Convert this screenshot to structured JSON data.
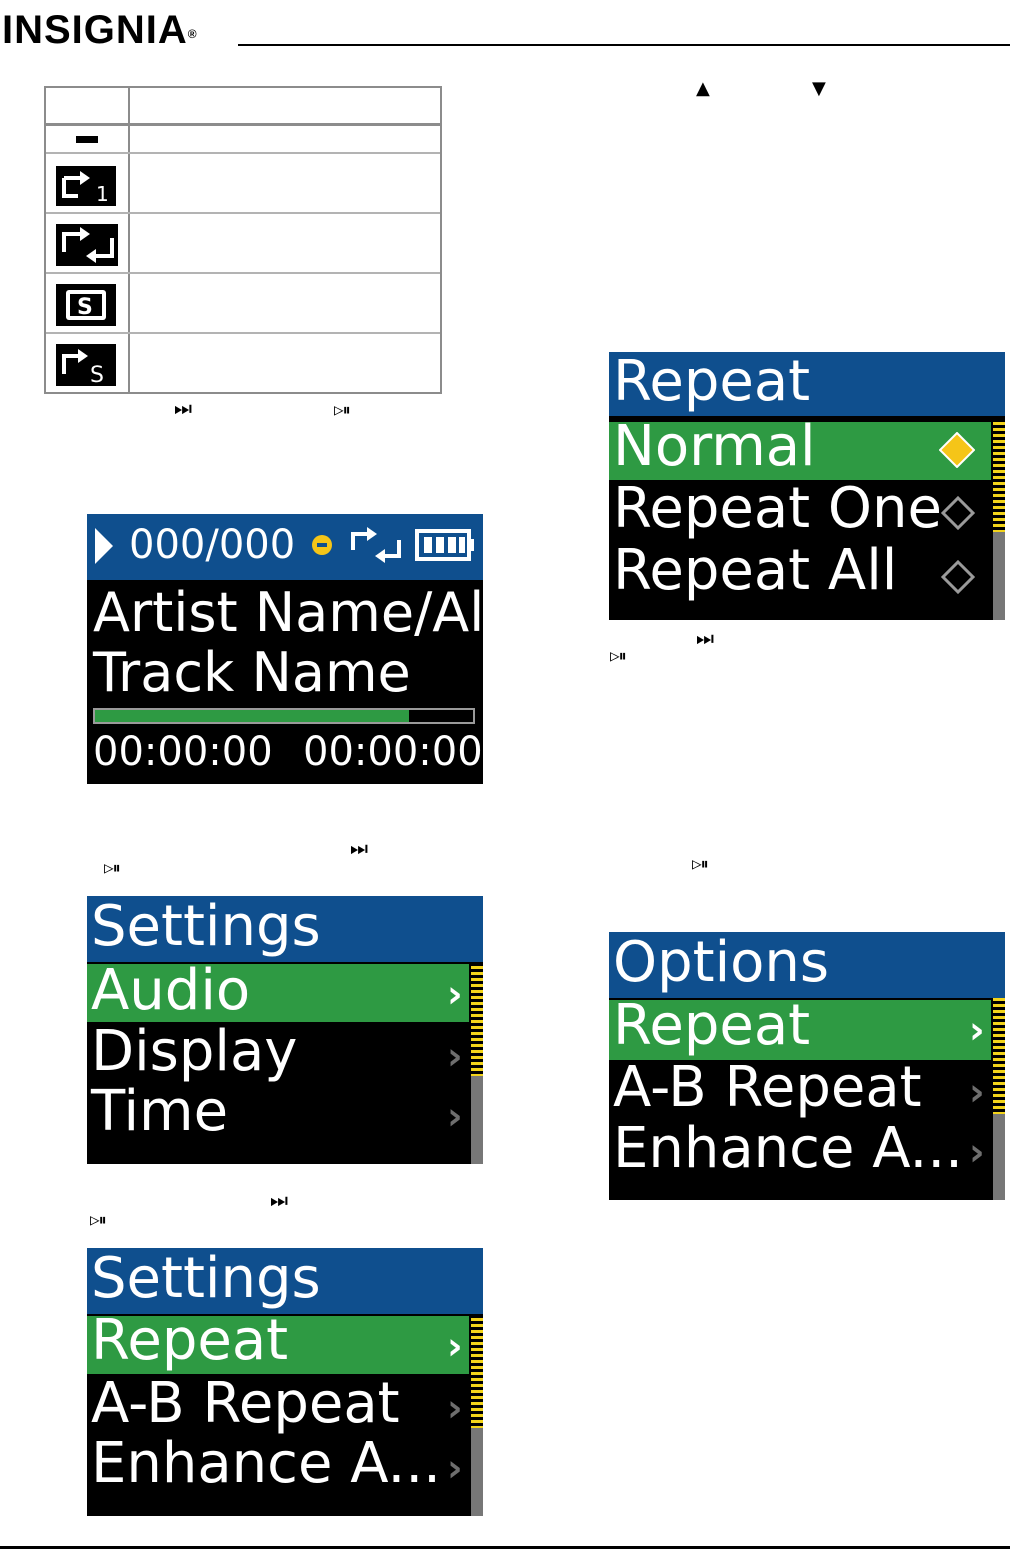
{
  "brand": {
    "name": "INSIGNIA",
    "registered": "®"
  },
  "icon_table": {
    "rows": [
      {
        "icon": "dash-icon"
      },
      {
        "icon": "repeat-one-icon",
        "badge": "1"
      },
      {
        "icon": "repeat-all-icon"
      },
      {
        "icon": "shuffle-icon",
        "badge": "S"
      },
      {
        "icon": "repeat-shuffle-icon",
        "badge": "S"
      }
    ]
  },
  "glyphs": {
    "next": "⏭",
    "play_pause": "▷⏸",
    "up": "▲",
    "down": "▼"
  },
  "now_playing": {
    "track_counter": "000/000",
    "line1": "Artist Name/Alb",
    "line2": "Track Name",
    "progress": 0.83,
    "elapsed": "00:00:00",
    "total": "00:00:00"
  },
  "settings_menu": {
    "title": "Settings",
    "items": [
      "Audio",
      "Display",
      "Time"
    ],
    "selected": 0
  },
  "audio_menu": {
    "title": "Settings",
    "items": [
      "Repeat",
      "A-B Repeat",
      "Enhance A..."
    ],
    "selected": 0
  },
  "repeat_menu": {
    "title": "Repeat",
    "items": [
      "Normal",
      "Repeat One",
      "Repeat All"
    ],
    "selected": 0
  },
  "options_menu": {
    "title": "Options",
    "items": [
      "Repeat",
      "A-B Repeat",
      "Enhance A..."
    ],
    "selected": 0
  },
  "colors": {
    "title_bar": "#0f4f8e",
    "selection": "#2e9a43",
    "scroll_thumb": "#f3d41a",
    "accent": "#f5c518"
  }
}
